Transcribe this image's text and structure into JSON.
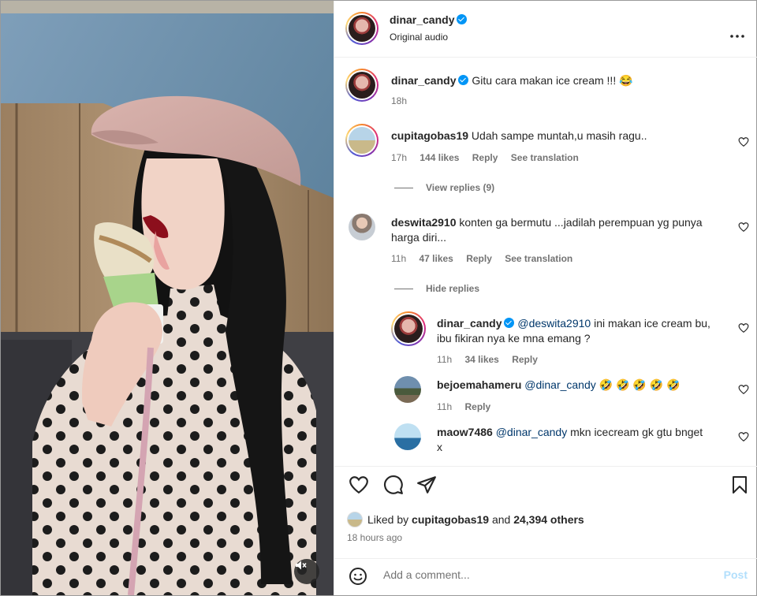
{
  "post": {
    "username": "dinar_candy",
    "audio": "Original audio",
    "more_icon": "more-horizontal-icon"
  },
  "caption": {
    "username": "dinar_candy",
    "text": "Gitu cara makan ice cream !!! 😂",
    "time": "18h"
  },
  "comments": [
    {
      "username": "cupitagobas19",
      "text": "Udah sampe muntah,u masih ragu..",
      "time": "17h",
      "likes": "144 likes",
      "reply": "Reply",
      "translate": "See translation",
      "replies_toggle": "View replies (9)"
    },
    {
      "username": "deswita2910",
      "text_line1": "konten ga bermutu ...jadilah perempuan yg punya",
      "text_line2": "harga diri...",
      "time": "11h",
      "likes": "47 likes",
      "reply": "Reply",
      "translate": "See translation",
      "replies_toggle": "Hide replies"
    }
  ],
  "replies": [
    {
      "username": "dinar_candy",
      "mention": "@deswita2910",
      "text_line1": "ini makan ice cream bu,",
      "text_line2": "ibu fikiran nya ke mna emang ?",
      "time": "11h",
      "likes": "34 likes",
      "reply": "Reply"
    },
    {
      "username": "bejoemahameru",
      "mention": "@dinar_candy",
      "text": "🤣 🤣 🤣 🤣 🤣",
      "time": "11h",
      "reply": "Reply"
    },
    {
      "username": "maow7486",
      "mention": "@dinar_candy",
      "text_line1": "mkn icecream gk gtu bnget",
      "text_line2": "x"
    }
  ],
  "footer": {
    "liked_prefix": "Liked by ",
    "liked_user": "cupitagobas19",
    "liked_middle": " and ",
    "liked_count": "24,394 others",
    "ago": "18 hours ago",
    "comment_placeholder": "Add a comment...",
    "post_label": "Post"
  },
  "colors": {
    "accent_blue": "#0095f6",
    "post_disabled": "#b2dffc",
    "muted_text": "#737373",
    "mention": "#00376b"
  },
  "icons": [
    "heart-icon",
    "comment-icon",
    "share-icon",
    "bookmark-icon",
    "emoji-icon",
    "mute-icon",
    "verified-badge-icon"
  ]
}
